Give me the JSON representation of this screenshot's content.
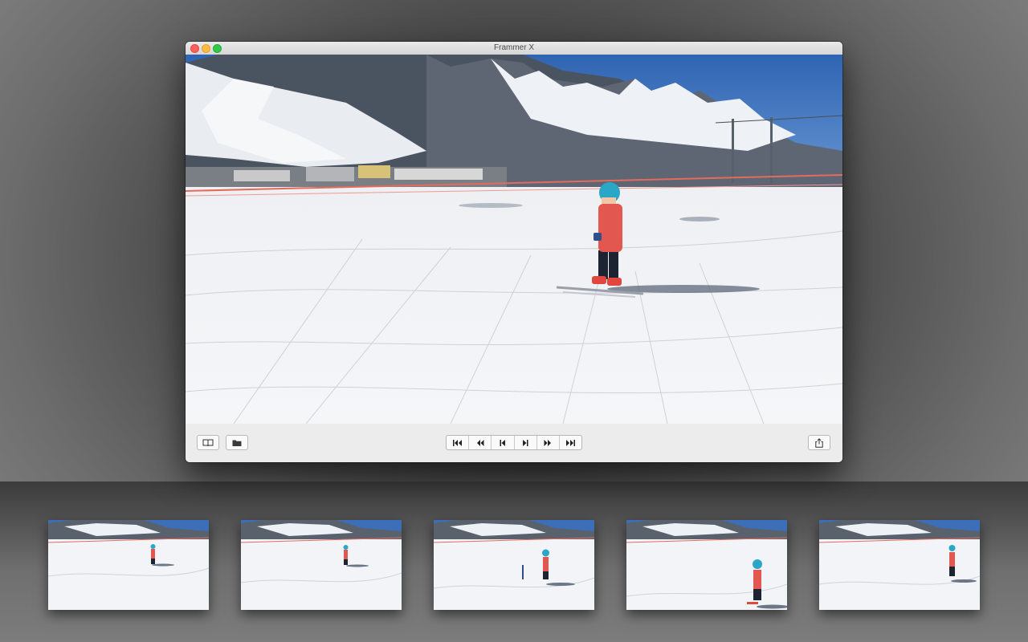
{
  "window": {
    "title": "Frammer X"
  },
  "toolbar": {
    "left_buttons": [
      {
        "icon": "book-icon"
      },
      {
        "icon": "folder-icon"
      }
    ],
    "transport_buttons": [
      {
        "icon": "skip-to-start-icon"
      },
      {
        "icon": "rewind-icon"
      },
      {
        "icon": "step-back-icon"
      },
      {
        "icon": "step-forward-icon"
      },
      {
        "icon": "fast-forward-icon"
      },
      {
        "icon": "skip-to-end-icon"
      }
    ],
    "right_button": {
      "icon": "share-icon"
    }
  },
  "thumbnails": [
    {
      "frame": 1
    },
    {
      "frame": 2
    },
    {
      "frame": 3
    },
    {
      "frame": 4
    },
    {
      "frame": 5
    }
  ],
  "colors": {
    "snow": "#f3f5f8",
    "sky": "#3d6fb8",
    "jacket": "#e2574f",
    "helmet": "#2aa7c7"
  }
}
